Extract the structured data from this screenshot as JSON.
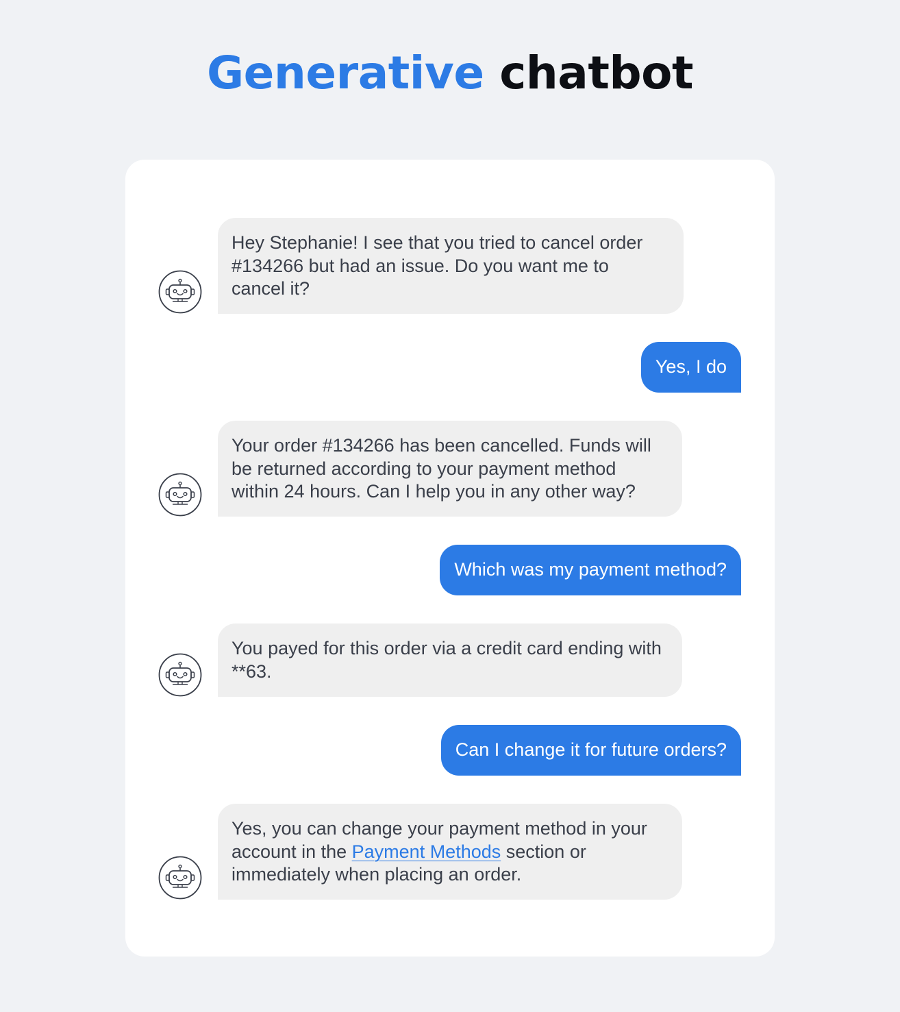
{
  "title": {
    "accent": "Generative",
    "rest": "chatbot"
  },
  "colors": {
    "accent": "#2c7be5",
    "background": "#f0f2f5",
    "bot_bubble": "#efefef",
    "bot_text": "#3a3f4a"
  },
  "bot_avatar_icon": "robot-icon",
  "messages": [
    {
      "from": "bot",
      "text": "Hey Stephanie! I see that you tried to cancel order #134266 but had an issue. Do you want me to cancel it?"
    },
    {
      "from": "user",
      "text": "Yes, I do"
    },
    {
      "from": "bot",
      "text": "Your order #134266 has been cancelled. Funds will be returned according to your payment method within 24 hours. Can I help you in any other way?"
    },
    {
      "from": "user",
      "text": "Which was my payment method?"
    },
    {
      "from": "bot",
      "text": "You payed for this order via a credit card ending with **63."
    },
    {
      "from": "user",
      "text": "Can I change it for future orders?"
    },
    {
      "from": "bot",
      "text_before": "Yes, you can change your payment method in your account in the",
      "link": "Payment Methods",
      "text_after": "section or immediately when placing an order."
    }
  ]
}
